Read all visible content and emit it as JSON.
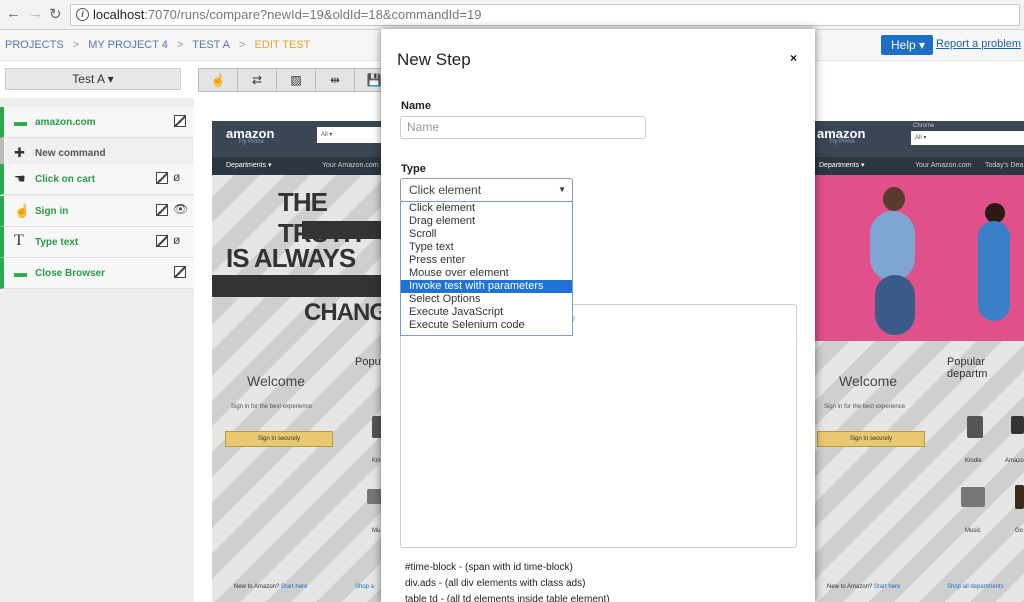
{
  "browser": {
    "url_host": "localhost",
    "url_rest": ":7070/runs/compare?newId=19&oldId=18&commandId=19",
    "back_icon": "←",
    "forward_icon": "→",
    "reload_icon": "↻",
    "info_icon": "i"
  },
  "header": {
    "breadcrumbs": [
      "PROJECTS",
      "MY PROJECT 4",
      "TEST A",
      "EDIT TEST"
    ],
    "separator": ">",
    "help_label": "Help ▾",
    "report_label": "Report a problem"
  },
  "toolbar": {
    "test_select": "Test A ▾",
    "tools": [
      "☝",
      "⇄",
      "▨",
      "⇹",
      "💾"
    ]
  },
  "steps": [
    {
      "label": "amazon.com",
      "icon": "▬",
      "eye": ""
    },
    {
      "label": "New command",
      "icon": "✚",
      "eye": ""
    },
    {
      "label": "Click on cart",
      "icon": "☚",
      "eye": "ø"
    },
    {
      "label": "Sign in",
      "icon": "☝",
      "eye": "👁"
    },
    {
      "label": "Type text",
      "icon": "T",
      "eye": "ø"
    },
    {
      "label": "Close Browser",
      "icon": "▬",
      "eye": ""
    }
  ],
  "preview_left": {
    "logo": "amazon",
    "logo_sub": "Try Prime",
    "search_dd": "All ▾",
    "dept": "Departments ▾",
    "your_amazon": "Your Amazon.com",
    "truth1": "THE TRUTH",
    "truth2": "IS ALWAYS",
    "truth3": "CHANGIN",
    "welcome": "Welcome",
    "signin_text": "Sign in for the best experience",
    "signin_btn": "Sign in securely",
    "popular": "Popu",
    "kindle": "Kin",
    "music": "Mu",
    "new_to": "New to Amazon?",
    "start_here": "Start here",
    "shop_all": "Shop a"
  },
  "preview_right": {
    "logo": "amazon",
    "logo_sub": "Try Prime",
    "search_dd": "All ▾",
    "search_top": "Chrome",
    "dept": "Departments ▾",
    "your_amazon": "Your Amazon.com",
    "todays_deals": "Today's Dea",
    "welcome": "Welcome",
    "signin_text": "Sign in for the best experience",
    "signin_btn": "Sign in securely",
    "popular": "Popular departm",
    "kindle": "Kindle",
    "amazon_lbl": "Amazo",
    "music": "Music",
    "go": "Go",
    "new_to": "New to Amazon?",
    "start_here": "Start here",
    "shop_all": "Shop all departments"
  },
  "modal": {
    "title": "New Step",
    "close": "×",
    "name_label": "Name",
    "name_placeholder": "Name",
    "type_label": "Type",
    "type_value": "Click element",
    "type_caret": "▼",
    "options": [
      "Click element",
      "Drag element",
      "Scroll",
      "Type text",
      "Press enter",
      "Mouse over element",
      "Invoke test with parameters",
      "Select Options",
      "Execute JavaScript",
      "Execute Selenium code"
    ],
    "selected_option_index": 6,
    "textarea_placeholder_tail": "ep",
    "hints": [
      "#time-block - (span with id time-block)",
      "div.ads - (all div elements with class ads)",
      "table td - (all td elements inside table element)"
    ]
  },
  "colors": {
    "accent_blue": "#1d6fc4",
    "step_green": "#2eaa4e",
    "breadcrumb_current": "#e0a030",
    "selected_option": "#1e72d8"
  }
}
